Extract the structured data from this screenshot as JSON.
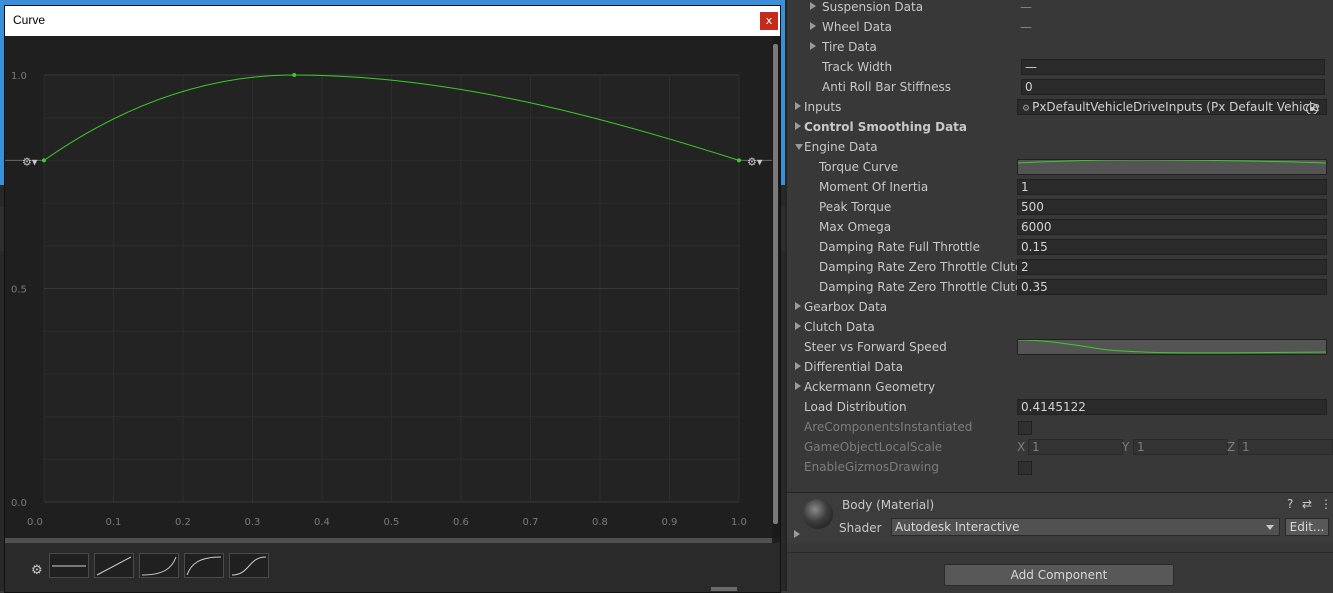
{
  "curve_window": {
    "title": "Curve",
    "close_glyph": "x",
    "y_ticks": [
      "1.0",
      "0.5",
      "0.0"
    ],
    "x_ticks": [
      "0.0",
      "0.1",
      "0.2",
      "0.3",
      "0.4",
      "0.5",
      "0.6",
      "0.7",
      "0.8",
      "0.9",
      "1.0"
    ],
    "curve_color": "#3ccc2a",
    "keyframes": [
      {
        "x": 0.0,
        "y": 0.8
      },
      {
        "x": 0.36,
        "y": 1.0
      },
      {
        "x": 1.0,
        "y": 0.8
      }
    ],
    "presets": [
      "constant",
      "linear",
      "ease-in",
      "ease-out",
      "ease-in-out"
    ]
  },
  "inspector": {
    "rows": [
      {
        "label": "Suspension Data",
        "fold": "closed",
        "indent": "deep",
        "value_type": "dash",
        "value": "—"
      },
      {
        "label": "Wheel Data",
        "fold": "closed",
        "indent": "deep",
        "value_type": "dash",
        "value": "—"
      },
      {
        "label": "Tire Data",
        "fold": "closed",
        "indent": "deep",
        "value_type": "none"
      },
      {
        "label": "Track Width",
        "fold": "none",
        "indent": "deep",
        "value_type": "field",
        "value": "—"
      },
      {
        "label": "Anti Roll Bar Stiffness",
        "fold": "none",
        "indent": "deep",
        "value_type": "field",
        "value": "0"
      },
      {
        "label": "Inputs",
        "fold": "closed",
        "indent": "top",
        "value_type": "object",
        "value": "PxDefaultVehicleDriveInputs (Px Default Vehicle"
      },
      {
        "label": "Control Smoothing Data",
        "fold": "closed",
        "indent": "top",
        "bold": true,
        "value_type": "none"
      },
      {
        "label": "Engine Data",
        "fold": "open",
        "indent": "top",
        "value_type": "none"
      },
      {
        "label": "Torque Curve",
        "fold": "none",
        "indent": "child",
        "value_type": "curve",
        "curve": "torque"
      },
      {
        "label": "Moment Of Inertia",
        "fold": "none",
        "indent": "child",
        "value_type": "field",
        "value": "1"
      },
      {
        "label": "Peak Torque",
        "fold": "none",
        "indent": "child",
        "value_type": "field",
        "value": "500"
      },
      {
        "label": "Max Omega",
        "fold": "none",
        "indent": "child",
        "value_type": "field",
        "value": "6000"
      },
      {
        "label": "Damping Rate Full Throttle",
        "fold": "none",
        "indent": "child",
        "value_type": "field",
        "value": "0.15"
      },
      {
        "label": "Damping Rate Zero Throttle Clutch",
        "fold": "none",
        "indent": "child",
        "value_type": "field",
        "value": "2"
      },
      {
        "label": "Damping Rate Zero Throttle Clutch",
        "fold": "none",
        "indent": "child",
        "value_type": "field",
        "value": "0.35"
      },
      {
        "label": "Gearbox Data",
        "fold": "closed",
        "indent": "top",
        "value_type": "none"
      },
      {
        "label": "Clutch Data",
        "fold": "closed",
        "indent": "top",
        "value_type": "none"
      },
      {
        "label": "Steer vs Forward Speed",
        "fold": "none",
        "indent": "top",
        "value_type": "curve",
        "curve": "steer"
      },
      {
        "label": "Differential Data",
        "fold": "closed",
        "indent": "top",
        "value_type": "none"
      },
      {
        "label": "Ackermann Geometry",
        "fold": "closed",
        "indent": "top",
        "value_type": "none"
      },
      {
        "label": "Load Distribution",
        "fold": "none",
        "indent": "top",
        "value_type": "field",
        "value": "0.4145122"
      },
      {
        "label": "AreComponentsInstantiated",
        "fold": "none",
        "indent": "top",
        "disabled": true,
        "value_type": "checkbox"
      },
      {
        "label": "GameObjectLocalScale",
        "fold": "none",
        "indent": "top",
        "disabled": true,
        "value_type": "vector3",
        "axes": [
          "X",
          "Y",
          "Z"
        ],
        "values": [
          "1",
          "1",
          "1"
        ]
      },
      {
        "label": "EnableGizmosDrawing",
        "fold": "none",
        "indent": "top",
        "disabled": true,
        "value_type": "checkbox"
      }
    ],
    "material": {
      "name": "Body (Material)",
      "shader_label": "Shader",
      "shader_value": "Autodesk Interactive",
      "edit_label": "Edit...",
      "help_glyph": "?",
      "preset_glyph": "⇄",
      "menu_glyph": "⋮"
    },
    "add_component_label": "Add Component"
  }
}
